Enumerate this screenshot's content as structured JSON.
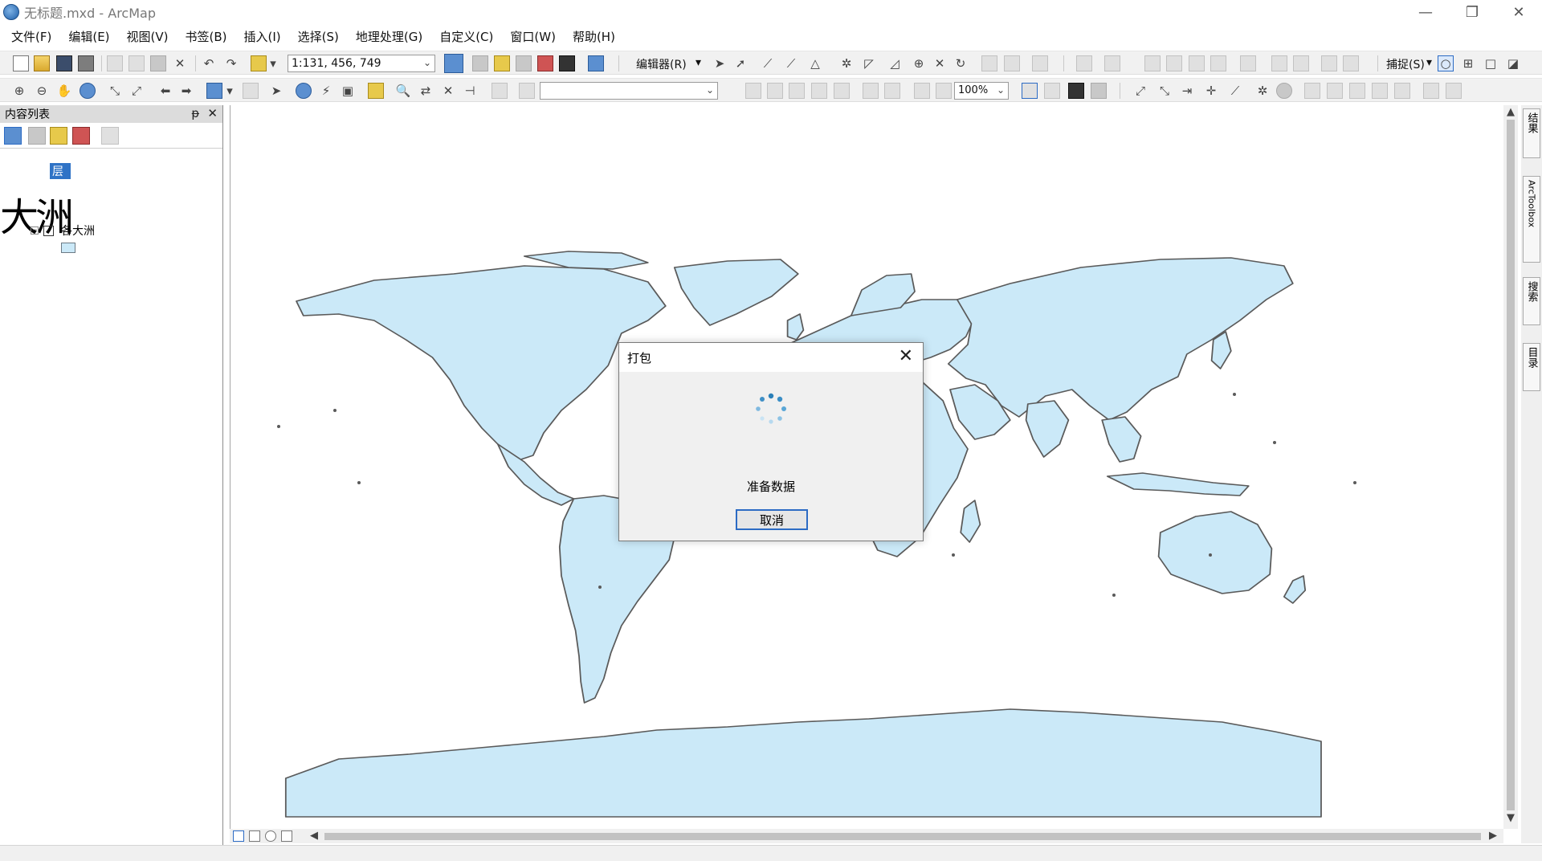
{
  "window": {
    "title": "无标题.mxd - ArcMap",
    "minimize": "—",
    "restore": "❐",
    "close": "✕"
  },
  "menu": [
    "文件(F)",
    "编辑(E)",
    "视图(V)",
    "书签(B)",
    "插入(I)",
    "选择(S)",
    "地理处理(G)",
    "自定义(C)",
    "窗口(W)",
    "帮助(H)"
  ],
  "toolbar": {
    "scale": "1:131, 456, 749",
    "editor_label": "编辑器(R)",
    "snapping_label": "捕捉(S)",
    "zoom_percent": "100%",
    "layout_combo": ""
  },
  "toc": {
    "title": "内容列表",
    "pin": "ᵽ",
    "close": "✕",
    "root_label": "层",
    "overlay_text": "大洲",
    "layer_name": "各大洲",
    "layer_checked": "✓",
    "expander": "−"
  },
  "side_tabs": [
    "结果",
    "ArcToolbox",
    "搜索",
    "目录"
  ],
  "dialog": {
    "title": "打包",
    "close": "✕",
    "message": "准备数据",
    "cancel_label": "取消"
  },
  "colors": {
    "land_fill": "#cbe9f8",
    "land_stroke": "#5a5a5a",
    "selection": "#2f73c6",
    "dialog_button_border": "#2c6bc4"
  }
}
